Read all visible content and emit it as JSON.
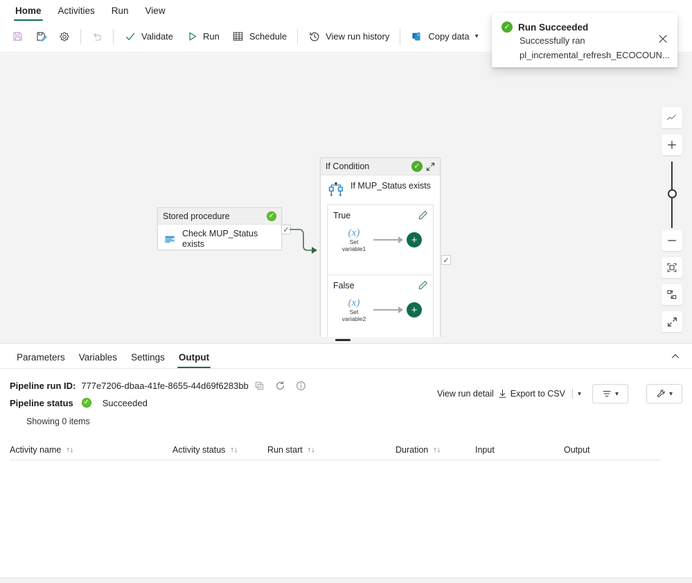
{
  "ribbon": {
    "tabs": [
      {
        "label": "Home",
        "active": true
      },
      {
        "label": "Activities",
        "active": false
      },
      {
        "label": "Run",
        "active": false
      },
      {
        "label": "View",
        "active": false
      }
    ]
  },
  "commandbar": {
    "items": [
      {
        "label": "",
        "icon": "save-icon",
        "name": "save-button"
      },
      {
        "label": "",
        "icon": "save-as-icon",
        "name": "save-as-button"
      },
      {
        "label": "",
        "icon": "gear-icon",
        "name": "settings-button"
      },
      {
        "label": "",
        "icon": "undo-icon",
        "name": "undo-button"
      },
      {
        "label": "Validate",
        "icon": "checkmark-icon",
        "name": "validate-button"
      },
      {
        "label": "Run",
        "icon": "play-icon",
        "name": "run-button"
      },
      {
        "label": "Schedule",
        "icon": "calendar-icon",
        "name": "schedule-button"
      },
      {
        "label": "View run history",
        "icon": "history-icon",
        "name": "view-run-history-button"
      },
      {
        "label": "Copy data",
        "icon": "copy-data-icon",
        "name": "copy-data-button"
      }
    ],
    "validate_label": "Validate",
    "run_label": "Run",
    "schedule_label": "Schedule",
    "view_run_history_label": "View run history",
    "copy_data_label": "Copy data"
  },
  "toast": {
    "title": "Run Succeeded",
    "line1": "Successfully ran",
    "line2": "pl_incremental_refresh_ECOCOUN...",
    "close_icon": "close-icon",
    "status_color": "#107c10"
  },
  "canvas": {
    "stored_procedure": {
      "header": "Stored procedure",
      "activity_name": "Check MUP_Status exists",
      "status_icon": "success-check-icon"
    },
    "if_condition": {
      "header": "If Condition",
      "activity_name": "If MUP_Status exists",
      "status_icon": "success-check-icon",
      "collapse_icon": "collapse-diagonal-icon",
      "branches": [
        {
          "name": "True",
          "edit_icon": "pencil-icon",
          "inner_activity": "Set variable1",
          "inner_symbol": "(x)",
          "add_label": "+"
        },
        {
          "name": "False",
          "edit_icon": "pencil-icon",
          "inner_activity": "Set variable2",
          "inner_symbol": "(x)",
          "add_label": "+"
        }
      ]
    },
    "tools": [
      {
        "name": "minimap-button",
        "icon": "minimap-icon"
      },
      {
        "name": "zoom-in-button",
        "icon": "plus-icon"
      },
      {
        "name": "zoom-out-button",
        "icon": "minus-icon"
      },
      {
        "name": "fit-to-screen-button",
        "icon": "fit-screen-icon"
      },
      {
        "name": "auto-align-button",
        "icon": "auto-align-icon"
      },
      {
        "name": "collapse-all-button",
        "icon": "collapse-diagonal-icon"
      }
    ]
  },
  "panel": {
    "tabs": [
      {
        "label": "Parameters",
        "active": false
      },
      {
        "label": "Variables",
        "active": false
      },
      {
        "label": "Settings",
        "active": false
      },
      {
        "label": "Output",
        "active": true
      }
    ],
    "collapse_icon": "chevron-up-icon",
    "run_id_label": "Pipeline run ID:",
    "run_id_value": "777e7206-dbaa-41fe-8655-44d69f6283bb",
    "copy_icon": "copy-icon",
    "refresh_icon": "refresh-icon",
    "info_icon": "info-icon",
    "status_label": "Pipeline status",
    "status_value": "Succeeded",
    "status_icon": "success-check-icon",
    "showing_text": "Showing 0 items",
    "actions": {
      "view_run_detail": "View run detail",
      "download_icon": "download-icon",
      "export_csv": "Export to CSV",
      "export_chevron_icon": "chevron-down-icon",
      "filter_icon": "filter-icon",
      "filter_chevron_icon": "chevron-down-icon",
      "tools_icon": "wrench-icon",
      "tools_chevron_icon": "chevron-down-icon"
    },
    "table": {
      "columns": [
        {
          "label": "Activity name",
          "sortable": true
        },
        {
          "label": "Activity status",
          "sortable": true
        },
        {
          "label": "Run start",
          "sortable": true
        },
        {
          "label": "Duration",
          "sortable": true
        },
        {
          "label": "Input",
          "sortable": false
        },
        {
          "label": "Output",
          "sortable": false
        }
      ],
      "rows": []
    }
  },
  "colors": {
    "accent": "#0f6c5a",
    "success": "#5ec32a",
    "plus": "#0f6c4d",
    "canvas_bg": "#f3f3f3"
  }
}
